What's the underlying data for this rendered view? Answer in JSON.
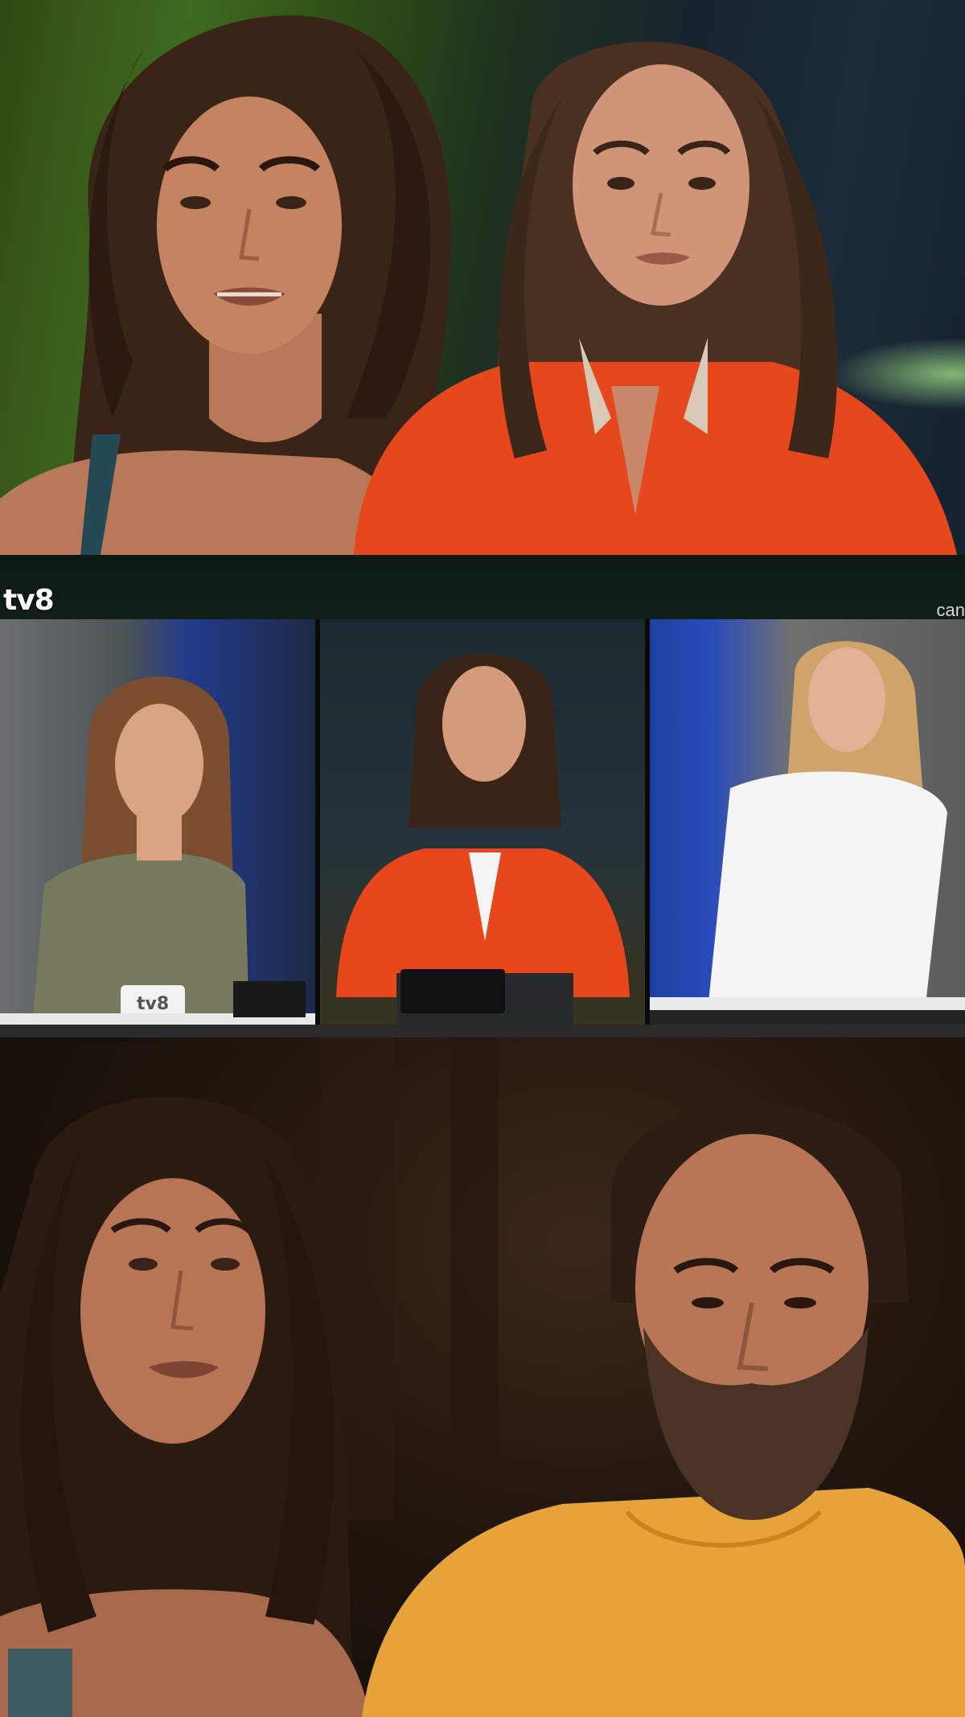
{
  "panels": {
    "mid": {
      "channel_logo": "tv8",
      "corner_text": "can",
      "mug_logo": "tv8"
    }
  }
}
